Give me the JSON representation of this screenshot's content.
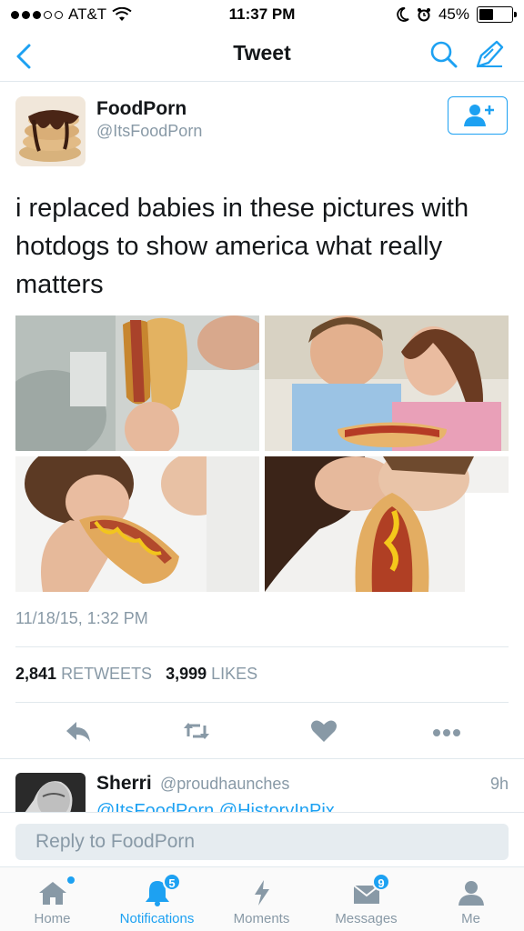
{
  "status_bar": {
    "carrier": "AT&T",
    "time": "11:37 PM",
    "battery": "45%",
    "battery_level": 0.45
  },
  "nav": {
    "title": "Tweet"
  },
  "tweet": {
    "author_name": "FoodPorn",
    "author_handle": "@ItsFoodPorn",
    "text": "i replaced babies in these pictures with hotdogs to show america what really matters",
    "timestamp": "11/18/15, 1:32 PM",
    "retweets_count": "2,841",
    "retweets_label": "RETWEETS",
    "likes_count": "3,999",
    "likes_label": "LIKES"
  },
  "reply_preview": {
    "name": "Sherri",
    "handle": "@proudhaunches",
    "time": "9h",
    "text": "@ItsFoodPorn @HistoryInPix"
  },
  "reply_bar": {
    "placeholder": "Reply to FoodPorn"
  },
  "tabs": [
    {
      "label": "Home",
      "icon": "home-icon"
    },
    {
      "label": "Notifications",
      "icon": "bell-icon",
      "badge": "5"
    },
    {
      "label": "Moments",
      "icon": "lightning-icon"
    },
    {
      "label": "Messages",
      "icon": "envelope-icon",
      "badge": "9"
    },
    {
      "label": "Me",
      "icon": "person-icon"
    }
  ],
  "colors": {
    "accent": "#1da1f2",
    "secondary_text": "#8899a6",
    "divider": "#e1e8ed"
  }
}
